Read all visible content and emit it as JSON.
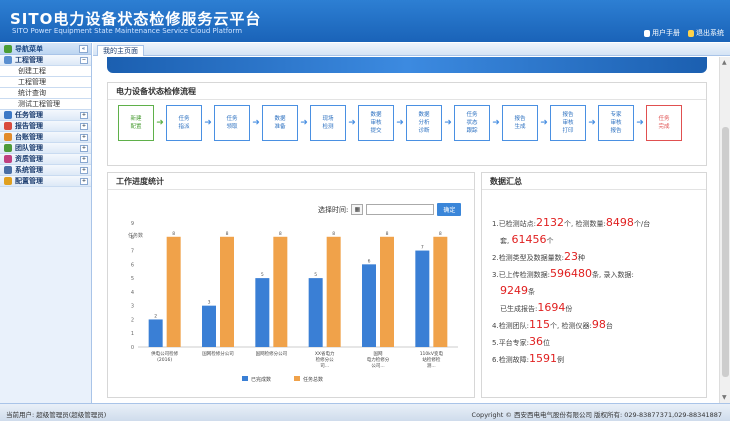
{
  "header": {
    "title": "SITO电力设备状态检修服务云平台",
    "subtitle": "SITO Power Equipment State Maintenance Service Cloud Platform",
    "links": [
      "用户手册",
      "退出系统"
    ]
  },
  "sidebar": {
    "head": "导航菜单",
    "items": [
      {
        "label": "工程管理",
        "type": "group",
        "color": "#5a8fd0"
      },
      {
        "label": "创建工程",
        "type": "sub"
      },
      {
        "label": "工程管理",
        "type": "sub"
      },
      {
        "label": "统计查询",
        "type": "sub"
      },
      {
        "label": "测试工程管理",
        "type": "sub"
      },
      {
        "label": "任务管理",
        "type": "group",
        "color": "#3c78c6"
      },
      {
        "label": "报告管理",
        "type": "group",
        "color": "#d94b3d"
      },
      {
        "label": "台账管理",
        "type": "group",
        "color": "#e28b2a"
      },
      {
        "label": "团队管理",
        "type": "group",
        "color": "#4e9a3a"
      },
      {
        "label": "资质管理",
        "type": "group",
        "color": "#c04080"
      },
      {
        "label": "系统管理",
        "type": "group",
        "color": "#4a6fa5"
      },
      {
        "label": "配置管理",
        "type": "group",
        "color": "#e0a020"
      }
    ]
  },
  "tabs": [
    "我的主页面"
  ],
  "flow": {
    "title": "电力设备状态检修流程",
    "steps": [
      "新建\n配置",
      "任务\n指派",
      "任务\n领取",
      "数据\n准备",
      "现场\n检测",
      "数据\n审核\n提交",
      "数据\n分析\n诊断",
      "任务\n状态\n跟踪",
      "报告\n生成",
      "报告\n审核\n打印",
      "专家\n审核\n报告",
      "任务\n完成"
    ]
  },
  "work_stats": {
    "title": "工作进度统计",
    "search_label": "选择时间:",
    "button": "确定"
  },
  "chart_data": {
    "type": "bar",
    "categories": [
      "供电公司检修\n(2016)",
      "国网检修分公司",
      "国网检修分公司",
      "XX省电力\n检修分公\n司...",
      "国网\n电力检修分\n公司...",
      "110kV变电\n站检修检\n测..."
    ],
    "series": [
      {
        "name": "已完成数",
        "color": "#3a7fd5",
        "values": [
          2,
          3,
          5,
          5,
          6,
          7
        ]
      },
      {
        "name": "任务总数",
        "color": "#f0a24a",
        "values": [
          8,
          8,
          8,
          8,
          8,
          8
        ]
      }
    ],
    "ylim": [
      0,
      9
    ],
    "yticks": [
      0,
      1,
      2,
      3,
      4,
      5,
      6,
      7,
      8,
      9
    ],
    "ylabel": "任务数"
  },
  "summary": {
    "title": "数据汇总",
    "lines": [
      {
        "n": "1.",
        "parts": [
          [
            "已检测站点:",
            ""
          ],
          [
            "2132",
            "big"
          ],
          [
            "个, 检测数量:",
            ""
          ],
          [
            "8498",
            "big"
          ],
          [
            "个/台",
            ""
          ]
        ]
      },
      {
        "n": "",
        "parts": [
          [
            "套, ",
            ""
          ],
          [
            "61456",
            "big"
          ],
          [
            "个",
            ""
          ]
        ]
      },
      {
        "n": "2.",
        "parts": [
          [
            "检测类型及数据量数:",
            ""
          ],
          [
            "23",
            "big"
          ],
          [
            "种",
            ""
          ]
        ]
      },
      {
        "n": "3.",
        "parts": [
          [
            "已上传检测数据:",
            ""
          ],
          [
            "596480",
            "big"
          ],
          [
            "条, 录入数据:",
            ""
          ]
        ]
      },
      {
        "n": "",
        "parts": [
          [
            "9249",
            "big"
          ],
          [
            "条",
            ""
          ]
        ]
      },
      {
        "n": "",
        "parts": [
          [
            "已生成报告:",
            ""
          ],
          [
            "1694",
            "big"
          ],
          [
            "份",
            ""
          ]
        ]
      },
      {
        "n": "4.",
        "parts": [
          [
            "检测团队:",
            ""
          ],
          [
            "115",
            "big"
          ],
          [
            "个, 检测仪器:",
            ""
          ],
          [
            "98",
            "big"
          ],
          [
            "台",
            ""
          ]
        ]
      },
      {
        "n": "5.",
        "parts": [
          [
            "平台专家:",
            ""
          ],
          [
            "36",
            "big"
          ],
          [
            "位",
            ""
          ]
        ]
      },
      {
        "n": "6.",
        "parts": [
          [
            "检测故障:",
            ""
          ],
          [
            "1591",
            "big"
          ],
          [
            "例",
            ""
          ]
        ]
      }
    ]
  },
  "footer": {
    "left": "当前用户: 超级管理员(超级管理员)",
    "right": "Copyright © 西安西电电气股份有限公司 版权所有: 029-83877371,029-88341887"
  }
}
